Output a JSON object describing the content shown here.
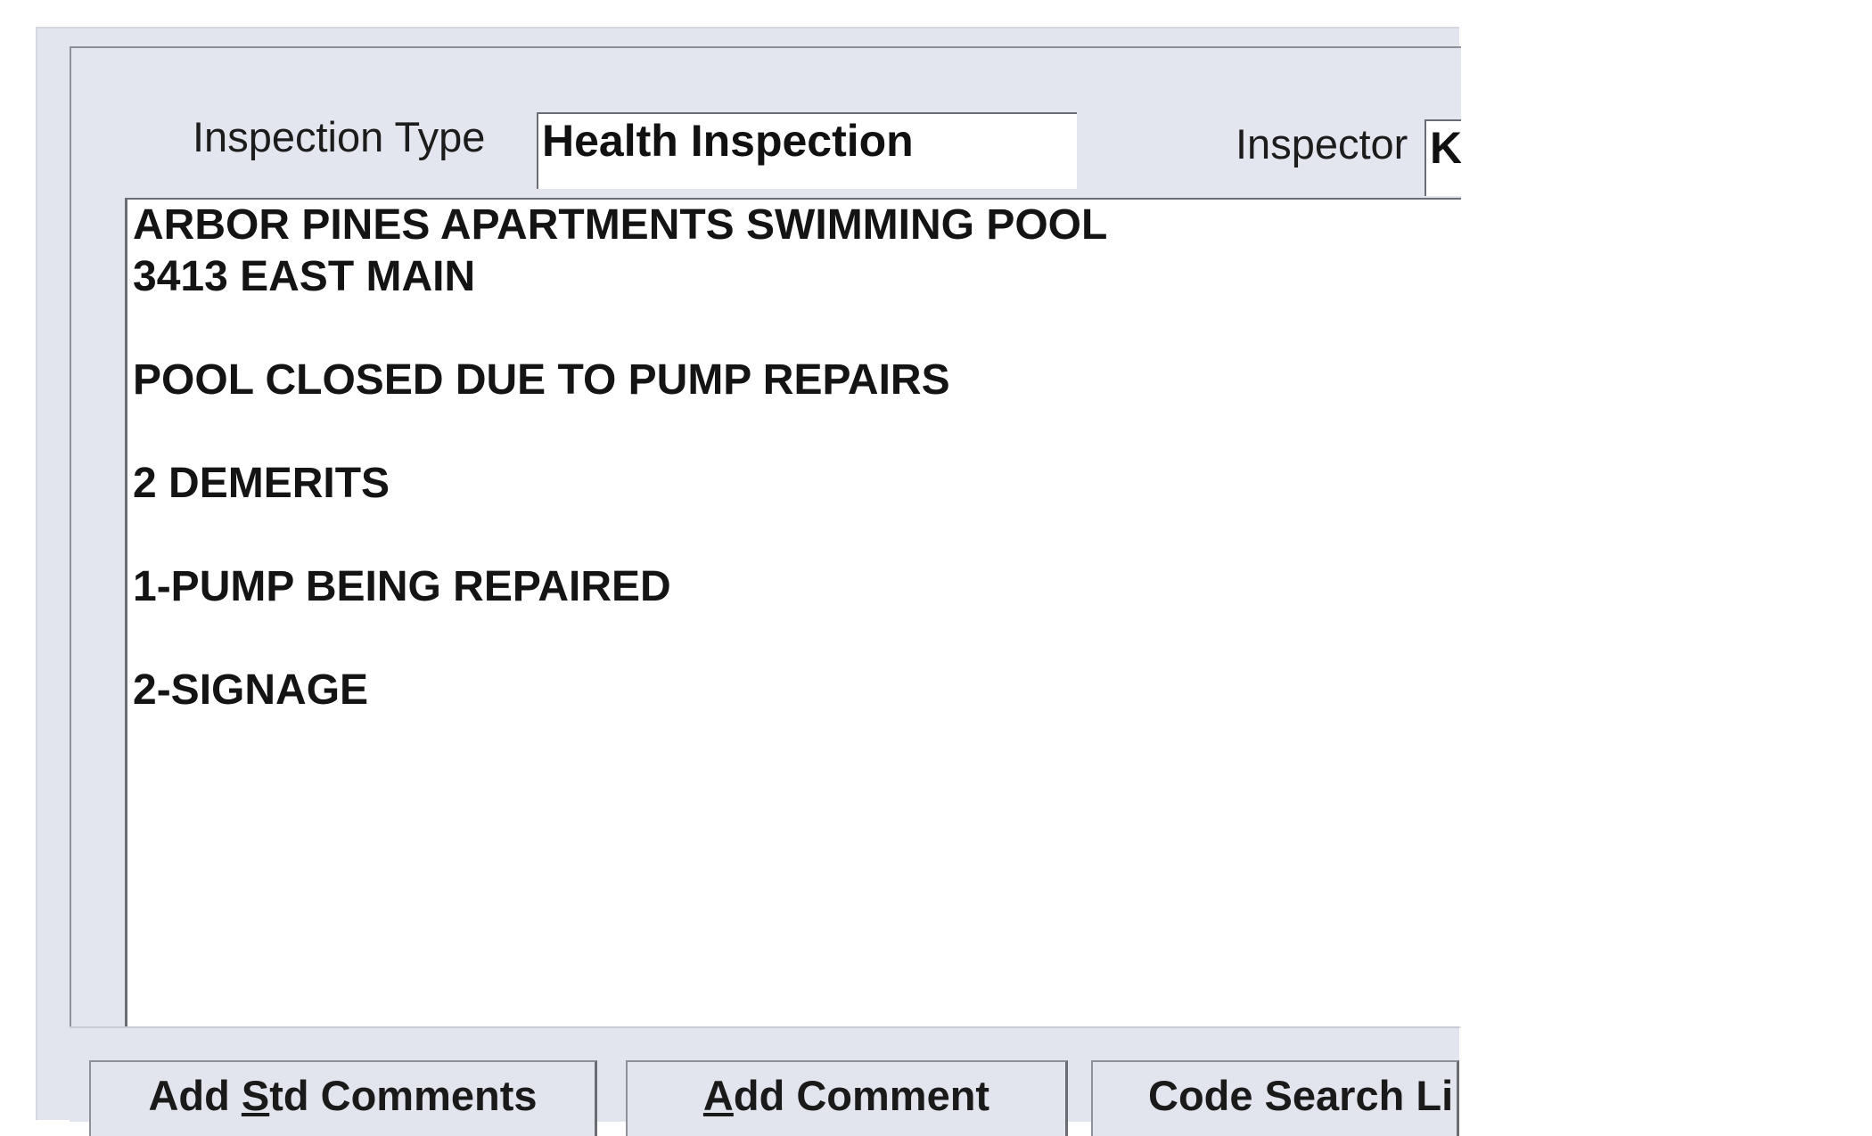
{
  "form": {
    "inspection_type_label": "Inspection Type",
    "inspection_type_value": "Health Inspection",
    "inspector_label": "Inspector",
    "inspector_value": "Ke"
  },
  "comments": {
    "lines": [
      "ARBOR PINES APARTMENTS SWIMMING POOL",
      "3413 EAST MAIN",
      "",
      "POOL CLOSED DUE TO PUMP REPAIRS",
      "",
      "2 DEMERITS",
      "",
      "1-PUMP BEING REPAIRED",
      "",
      "2-SIGNAGE"
    ]
  },
  "buttons": {
    "add_std_comments": {
      "pre": "Add ",
      "mnemonic": "S",
      "post": "td Comments"
    },
    "add_comment": {
      "pre": "",
      "mnemonic": "A",
      "post": "dd Comment"
    },
    "code_search": {
      "label": "Code Search Li"
    }
  }
}
